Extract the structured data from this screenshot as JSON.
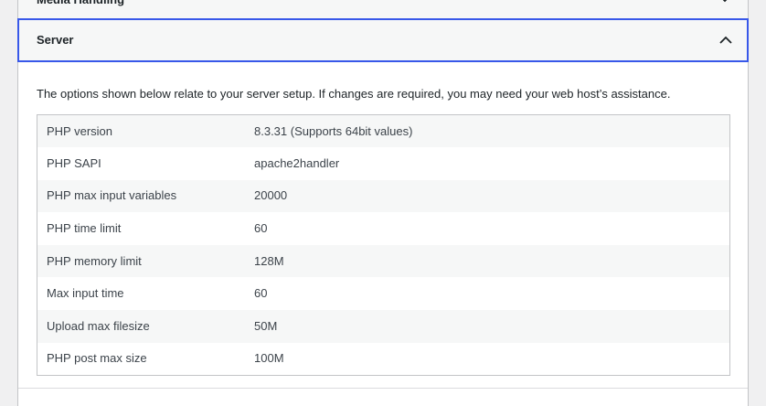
{
  "previous_section": {
    "title": "Media Handling"
  },
  "section": {
    "title": "Server",
    "expanded": true,
    "description": "The options shown below relate to your server setup. If changes are required, you may need your web host’s assistance."
  },
  "rows": [
    {
      "label": "PHP version",
      "value": "8.3.31 (Supports 64bit values)"
    },
    {
      "label": "PHP SAPI",
      "value": "apache2handler"
    },
    {
      "label": "PHP max input variables",
      "value": "20000"
    },
    {
      "label": "PHP time limit",
      "value": "60"
    },
    {
      "label": "PHP memory limit",
      "value": "128M"
    },
    {
      "label": "Max input time",
      "value": "60"
    },
    {
      "label": "Upload max filesize",
      "value": "50M"
    },
    {
      "label": "PHP post max size",
      "value": "100M"
    }
  ],
  "colors": {
    "focus_border": "#3858e9",
    "header_bg": "#f6f7f7",
    "page_bg": "#f0f0f1"
  }
}
